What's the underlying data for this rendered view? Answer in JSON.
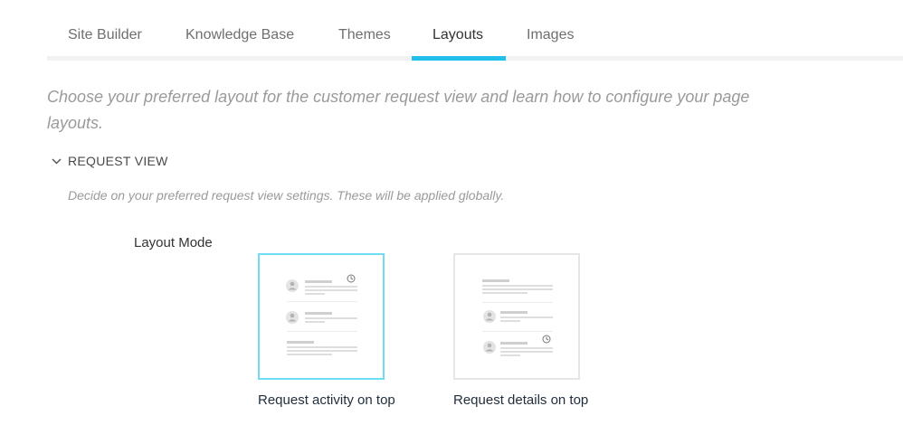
{
  "tabs": [
    {
      "label": "Site Builder",
      "active": false
    },
    {
      "label": "Knowledge Base",
      "active": false
    },
    {
      "label": "Themes",
      "active": false
    },
    {
      "label": "Layouts",
      "active": true
    },
    {
      "label": "Images",
      "active": false
    }
  ],
  "intro": "Choose your preferred layout for the customer request view and learn how to configure your page layouts.",
  "section": {
    "title": "REQUEST VIEW",
    "expanded": true,
    "description": "Decide on your preferred request view settings. These will be applied globally."
  },
  "layout_mode": {
    "label": "Layout Mode",
    "options": [
      {
        "label": "Request activity on top",
        "selected": true
      },
      {
        "label": "Request details on top",
        "selected": false
      }
    ]
  },
  "colors": {
    "accent": "#21bfea",
    "selected_border": "#6edcf3",
    "muted_text": "#9a9a9a"
  },
  "icons": {
    "section_toggle": "chevron-down-icon",
    "avatar": "user-avatar-icon",
    "clock": "clock-icon"
  }
}
